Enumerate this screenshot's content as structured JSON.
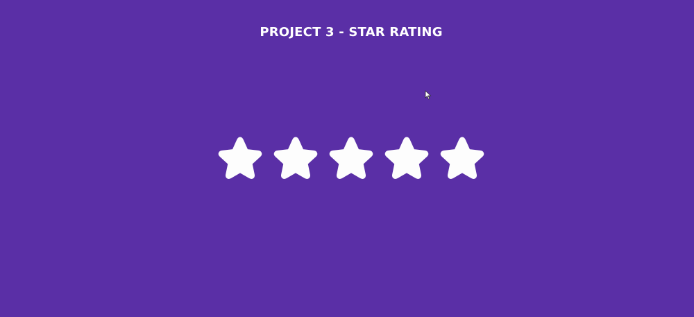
{
  "title": "PROJECT 3 - STAR RATING",
  "colors": {
    "background": "#5a2fa6",
    "star_fill": "#fdfdfd",
    "title_text": "#ffffff"
  },
  "rating": {
    "max": 5,
    "filled": 5
  },
  "icons": {
    "star": "star-icon",
    "cursor": "mouse-pointer-icon"
  }
}
